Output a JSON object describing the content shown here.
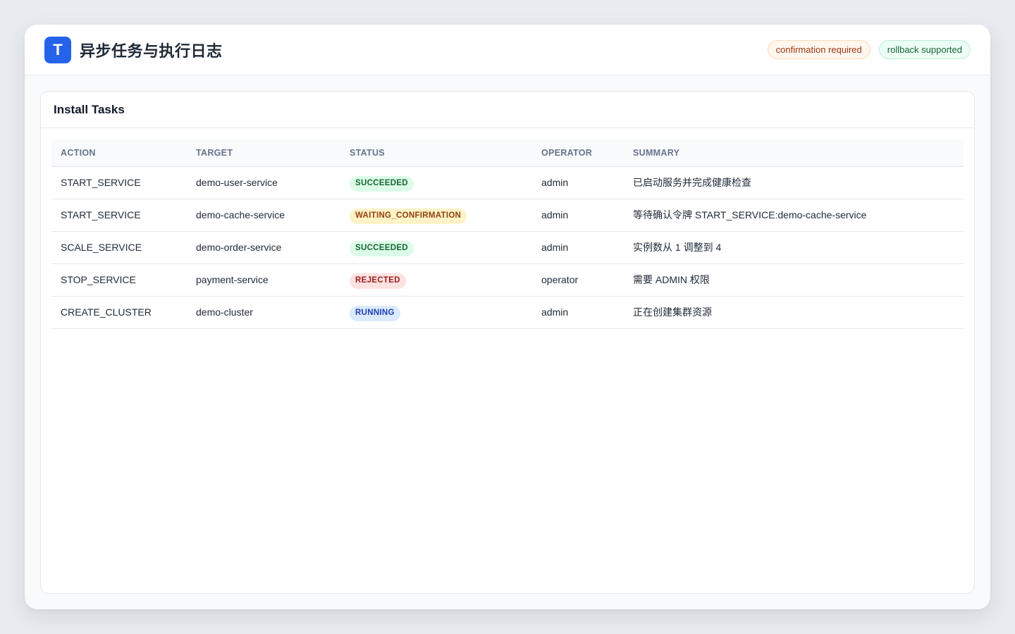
{
  "app": {
    "logo_letter": "T",
    "title": "异步任务与执行日志",
    "badges": {
      "confirmation": "confirmation required",
      "rollback": "rollback supported"
    }
  },
  "panel": {
    "title": "Install Tasks",
    "columns": {
      "action": "ACTION",
      "target": "TARGET",
      "status": "STATUS",
      "operator": "OPERATOR",
      "summary": "SUMMARY"
    },
    "rows": [
      {
        "action": "START_SERVICE",
        "target": "demo-user-service",
        "status": "SUCCEEDED",
        "status_kind": "succeeded",
        "operator": "admin",
        "summary": "已启动服务并完成健康检查"
      },
      {
        "action": "START_SERVICE",
        "target": "demo-cache-service",
        "status": "WAITING_CONFIRMATION",
        "status_kind": "waiting",
        "operator": "admin",
        "summary": "等待确认令牌 START_SERVICE:demo-cache-service"
      },
      {
        "action": "SCALE_SERVICE",
        "target": "demo-order-service",
        "status": "SUCCEEDED",
        "status_kind": "succeeded",
        "operator": "admin",
        "summary": "实例数从 1 调整到 4"
      },
      {
        "action": "STOP_SERVICE",
        "target": "payment-service",
        "status": "REJECTED",
        "status_kind": "rejected",
        "operator": "operator",
        "summary": "需要 ADMIN 权限"
      },
      {
        "action": "CREATE_CLUSTER",
        "target": "demo-cluster",
        "status": "RUNNING",
        "status_kind": "running",
        "operator": "admin",
        "summary": "正在创建集群资源"
      }
    ]
  },
  "colors": {
    "accent": "#2563eb",
    "succeeded": "#dcfce7",
    "waiting": "#fef3c7",
    "rejected": "#fee2e2",
    "running": "#dbeafe"
  }
}
